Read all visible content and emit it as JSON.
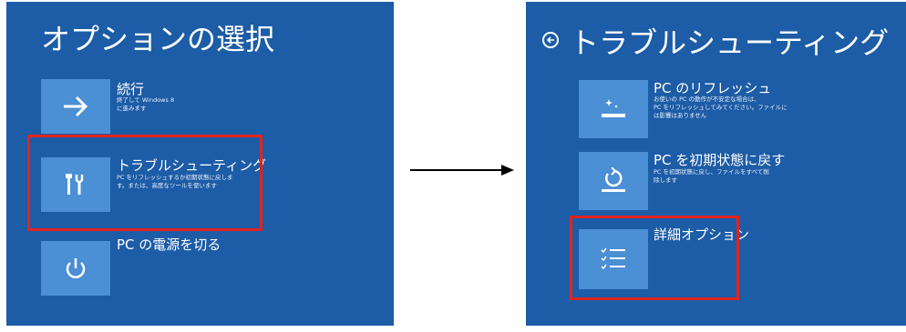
{
  "left": {
    "title": "オプションの選択",
    "options": [
      {
        "label": "続行",
        "desc": "終了して Windows 8\nに進みます",
        "icon": "arrow-right-icon"
      },
      {
        "label": "トラブルシューティング",
        "desc": "PC をリフレッシュするか初期状態に戻しま\nす。または、高度なツールを使います",
        "icon": "tools-icon"
      },
      {
        "label": "PC の電源を切る",
        "desc": "",
        "icon": "power-icon"
      }
    ]
  },
  "right": {
    "title": "トラブルシューティング",
    "options": [
      {
        "label": "PC のリフレッシュ",
        "desc": "お使いの PC の動作が不安定な場合は、\nPC をリフレッシュしてみてください。ファイルに\nは影響はありません",
        "icon": "refresh-pc-icon"
      },
      {
        "label": "PC を初期状態に戻す",
        "desc": "PC を初期状態に戻し、ファイルをすべて削\n除します",
        "icon": "reset-pc-icon"
      },
      {
        "label": "詳細オプション",
        "desc": "",
        "icon": "checklist-icon"
      }
    ]
  },
  "colors": {
    "panel": "#1d5ca6",
    "tile": "#4b8fd5",
    "highlight": "#e0231f"
  }
}
